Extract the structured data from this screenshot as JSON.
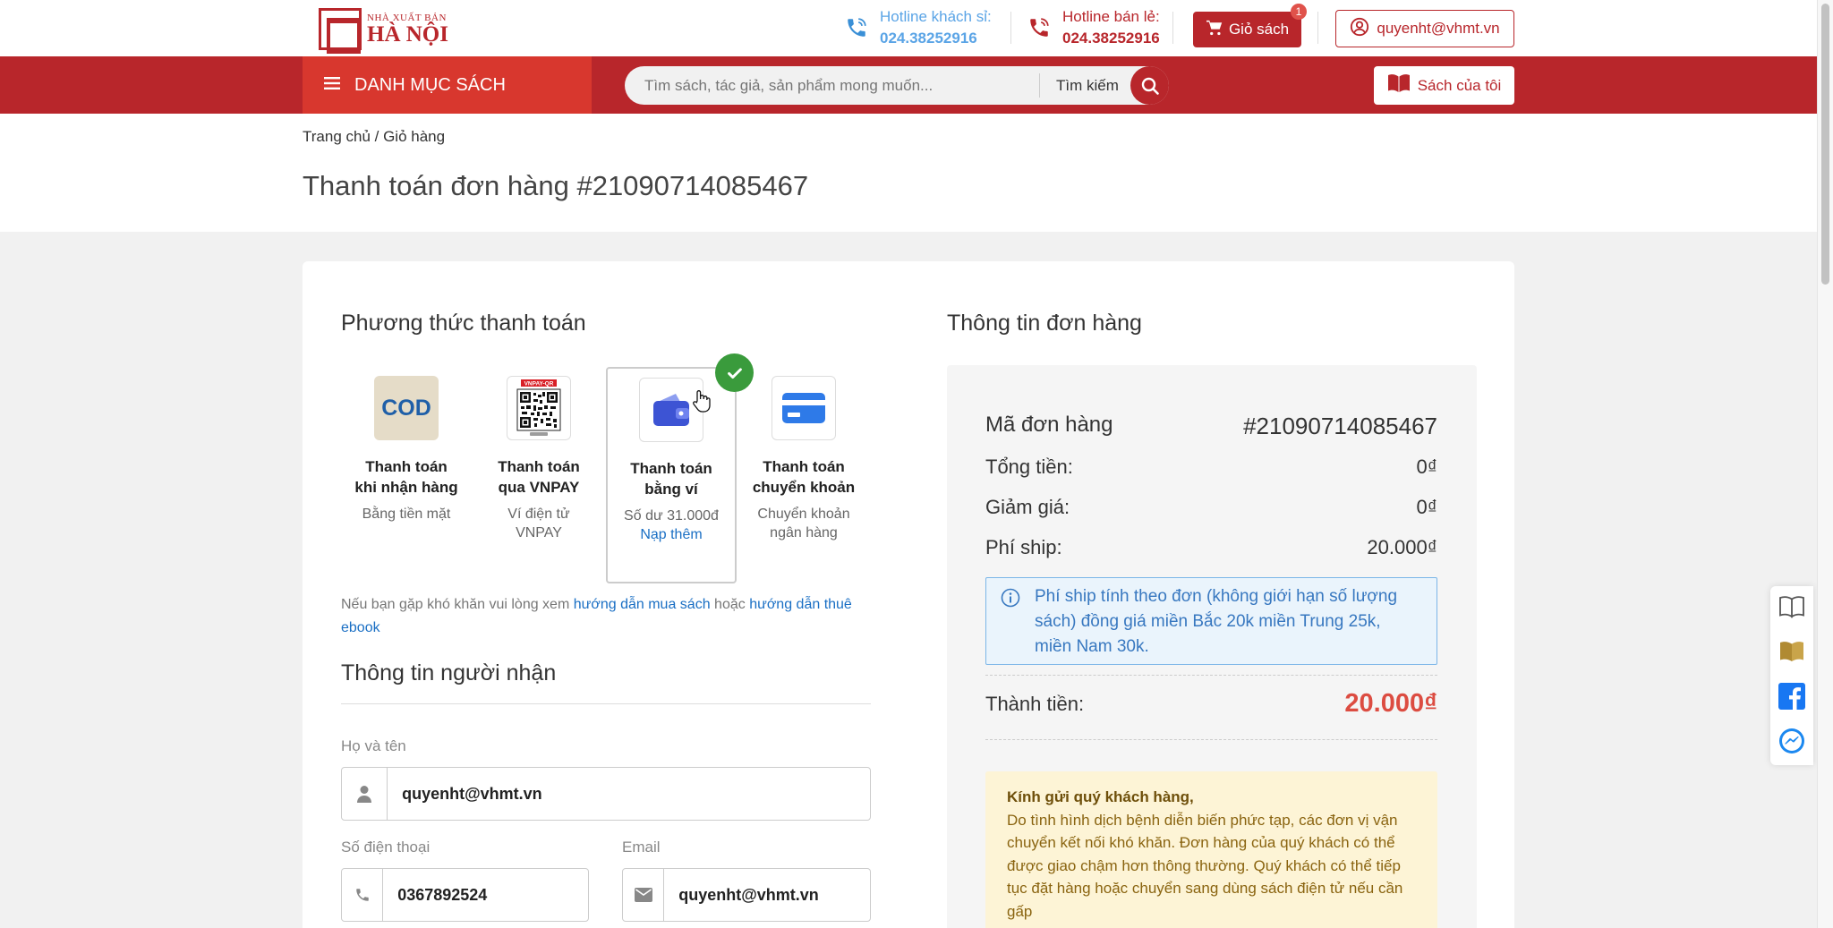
{
  "header": {
    "logo_small": "NHÀ XUẤT BẢN",
    "logo_big": "HÀ NỘI",
    "hotline1_label": "Hotline khách sỉ:",
    "hotline1_number": "024.38252916",
    "hotline2_label": "Hotline bán lẻ:",
    "hotline2_number": "024.38252916",
    "cart_label": "Giỏ sách",
    "cart_count": "1",
    "user_label": "quyenht@vhmt.vn"
  },
  "nav": {
    "category_label": "DANH MỤC SÁCH",
    "search_placeholder": "Tìm sách, tác giả, sản phẩm mong muốn...",
    "search_button": "Tìm kiếm",
    "my_books": "Sách của tôi"
  },
  "breadcrumb": "Trang chủ / Giỏ hàng",
  "page_title": "Thanh toán đơn hàng #21090714085467",
  "payment": {
    "heading": "Phương thức thanh toán",
    "methods": [
      {
        "icon": "cod-icon",
        "icon_text": "COD",
        "title1": "Thanh toán",
        "title2": "khi nhận hàng",
        "sub1": "Bằng tiền mặt",
        "sub2": ""
      },
      {
        "icon": "vnpay-qr-icon",
        "icon_text": "VNPAY-QR",
        "title1": "Thanh toán",
        "title2": "qua VNPAY",
        "sub1": "Ví điện tử",
        "sub2": "VNPAY"
      },
      {
        "icon": "wallet-icon",
        "title1": "Thanh toán",
        "title2": "bằng ví",
        "sub1": "Số dư 31.000đ",
        "action": "Nạp thêm",
        "selected": true
      },
      {
        "icon": "credit-card-icon",
        "title1": "Thanh toán",
        "title2": "chuyển khoản",
        "sub1": "Chuyển khoản",
        "sub2": "ngân hàng"
      }
    ],
    "help_prefix": "Nếu bạn gặp khó khăn vui lòng xem",
    "help_link1": "hướng dẫn mua sách",
    "help_mid": "hoặc",
    "help_link2": "hướng dẫn thuê ebook"
  },
  "recipient": {
    "heading": "Thông tin người nhận",
    "name_label": "Họ và tên",
    "name_value": "quyenht@vhmt.vn",
    "phone_label": "Số điện thoại",
    "phone_value": "0367892524",
    "email_label": "Email",
    "email_value": "quyenht@vhmt.vn"
  },
  "order": {
    "heading": "Thông tin đơn hàng",
    "code_label": "Mã đơn hàng",
    "code_value": "#21090714085467",
    "total_label": "Tổng tiền:",
    "total_value": "0₫",
    "discount_label": "Giảm giá:",
    "discount_value": "0₫",
    "ship_label": "Phí ship:",
    "ship_value": "20.000₫",
    "ship_note": "Phí ship tính theo đơn (không giới hạn số lượng sách) đồng giá miền Bắc 20k miền Trung 25k, miền Nam 30k.",
    "grand_label": "Thành tiền:",
    "grand_value": "20.000₫",
    "notice_title": "Kính gửi quý khách hàng,",
    "notice_body": "Do tình hình dịch bệnh diễn biến phức tạp, các đơn vị vận chuyển kết nối khó khăn. Đơn hàng của quý khách có thể được giao chậm hơn thông thường. Quý khách có thể tiếp tục đặt hàng hoặc chuyển sang dùng sách điện tử nếu cần gấp"
  },
  "colors": {
    "brand": "#b8262b",
    "accent": "#d8372e",
    "link": "#1a6fc4",
    "price": "#dc4c41",
    "success": "#3a9b3c"
  }
}
